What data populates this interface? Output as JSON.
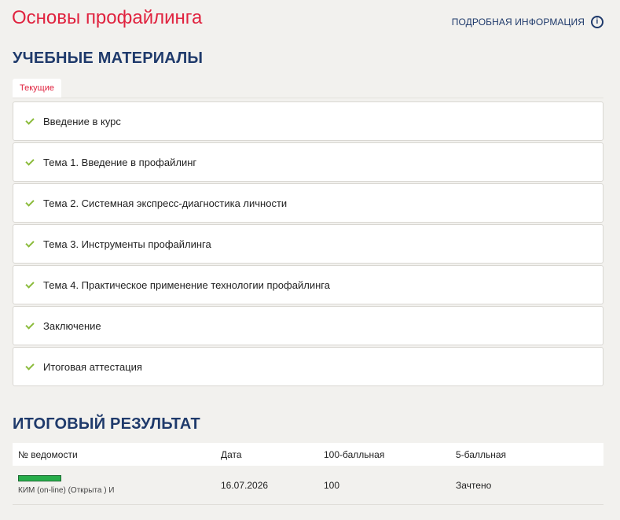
{
  "page": {
    "title": "Основы профайлинга",
    "info_link": "ПОДРОБНАЯ ИНФОРМАЦИЯ",
    "info_icon": "info-icon"
  },
  "materials": {
    "heading": "УЧЕБНЫЕ МАТЕРИАЛЫ",
    "tab": "Текущие",
    "items": [
      {
        "label": "Введение в курс",
        "status": "done"
      },
      {
        "label": "Тема 1. Введение в профайлинг",
        "status": "done"
      },
      {
        "label": "Тема 2. Системная экспресс-диагностика личности",
        "status": "done"
      },
      {
        "label": "Тема 3. Инструменты профайлинга",
        "status": "done"
      },
      {
        "label": "Тема 4. Практическое применение технологии профайлинга",
        "status": "done"
      },
      {
        "label": "Заключение",
        "status": "done"
      },
      {
        "label": "Итоговая аттестация",
        "status": "done"
      }
    ]
  },
  "result": {
    "heading": "ИТОГОВЫЙ РЕЗУЛЬТАТ",
    "columns": [
      "№ ведомости",
      "Дата",
      "100-балльная",
      "5-балльная"
    ],
    "rows": [
      {
        "progress": 1.0,
        "doc": "КИМ (on-line) (Открыта ) И",
        "date": "16.07.2026",
        "score100": "100",
        "score5": "Зачтено"
      }
    ]
  },
  "colors": {
    "accent": "#e0233f",
    "heading": "#1f3a6b",
    "check": "#8bbb3b",
    "progress": "#27ad4a"
  }
}
